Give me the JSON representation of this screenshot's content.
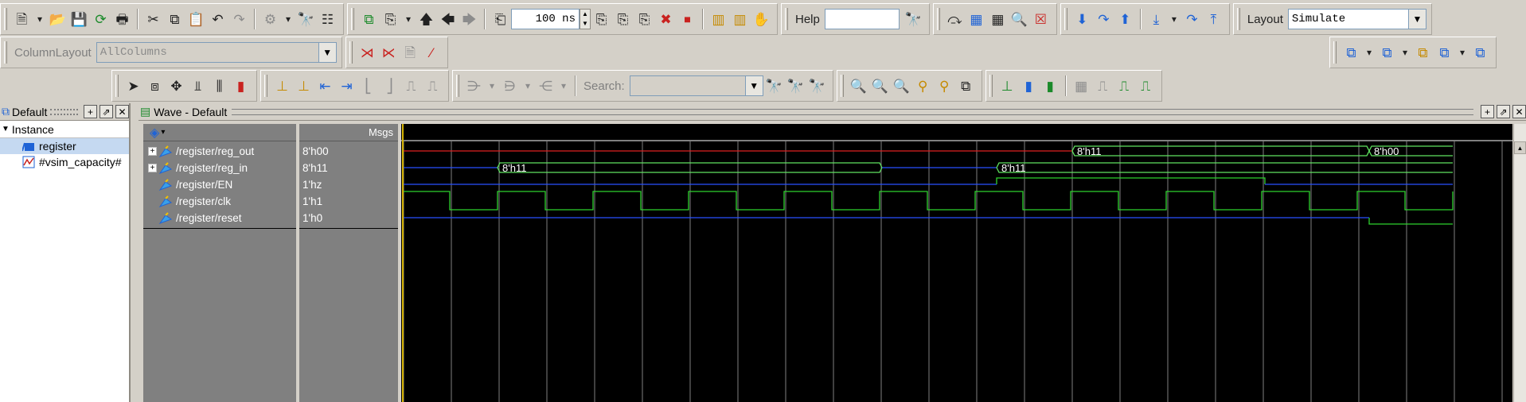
{
  "toolbar": {
    "time_step": "100 ns",
    "help_label": "Help",
    "help_value": "",
    "layout_label": "Layout",
    "layout_value": "Simulate",
    "column_layout_label": "ColumnLayout",
    "column_layout_value": "AllColumns",
    "search_label": "Search:",
    "search_value": ""
  },
  "left_panel": {
    "title": "Default",
    "column_header": "Instance",
    "items": [
      {
        "label": "register",
        "icon": "module-icon",
        "selected": true
      },
      {
        "label": "#vsim_capacity#",
        "icon": "capacity-icon",
        "selected": false
      }
    ]
  },
  "wave": {
    "title": "Wave - Default",
    "msgs_header": "Msgs",
    "signals": [
      {
        "name": "/register/reg_out",
        "value": "8'h00",
        "expandable": true
      },
      {
        "name": "/register/reg_in",
        "value": "8'h11",
        "expandable": true
      },
      {
        "name": "/register/EN",
        "value": "1'hz",
        "expandable": false
      },
      {
        "name": "/register/clk",
        "value": "1'h1",
        "expandable": false
      },
      {
        "name": "/register/reset",
        "value": "1'h0",
        "expandable": false
      }
    ],
    "bus_labels": {
      "reg_out_1": "8'h11",
      "reg_out_2": "8'h00",
      "reg_in_1": "8'h11",
      "reg_in_2": "8'h11"
    },
    "colors": {
      "grid": "#808080",
      "bus_green": "#5fe35f",
      "clock_green": "#2ed12e",
      "red": "#e02020",
      "blue": "#2850ff",
      "cursor": "#d6b400",
      "background": "#000000"
    }
  }
}
